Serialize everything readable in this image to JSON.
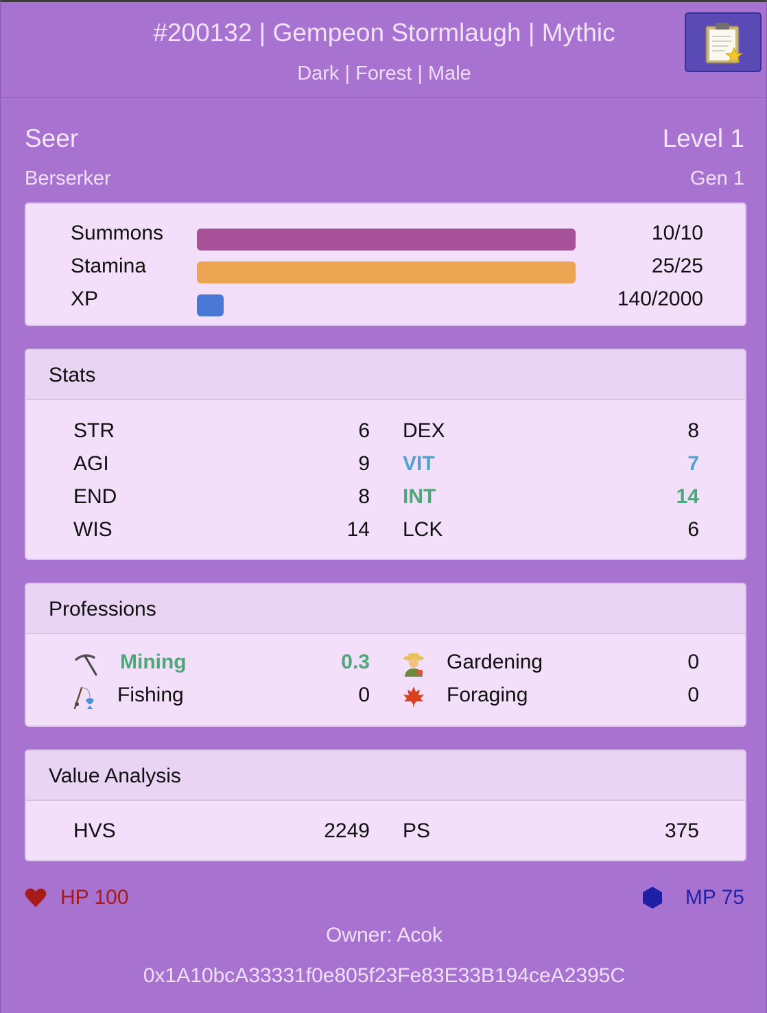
{
  "header": {
    "title": "#200132 | Gempeon Stormlaugh | Mythic",
    "subtitle": "Dark | Forest | Male",
    "clipboard_icon": "clipboard-star-icon"
  },
  "identity": {
    "main_class": "Seer",
    "level": "Level 1",
    "sub_class": "Berserker",
    "generation": "Gen 1"
  },
  "bars": [
    {
      "label": "Summons",
      "value": "10/10",
      "fraction": 1.0,
      "color": "#a65198"
    },
    {
      "label": "Stamina",
      "value": "25/25",
      "fraction": 1.0,
      "color": "#eca552"
    },
    {
      "label": "XP",
      "value": "140/2000",
      "fraction": 0.07,
      "color": "#4a78d6"
    }
  ],
  "stats": {
    "title": "Stats",
    "rows": [
      {
        "left_label": "STR",
        "left_value": "6",
        "right_label": "DEX",
        "right_value": "8"
      },
      {
        "left_label": "AGI",
        "left_value": "9",
        "right_label": "VIT",
        "right_value": "7"
      },
      {
        "left_label": "END",
        "left_value": "8",
        "right_label": "INT",
        "right_value": "14"
      },
      {
        "left_label": "WIS",
        "left_value": "14",
        "right_label": "LCK",
        "right_value": "6"
      }
    ],
    "highlight_colors": {
      "VIT": "#52a2cf",
      "INT": "#4ea779"
    }
  },
  "professions": {
    "title": "Professions",
    "rows": [
      {
        "left_icon": "pickaxe-icon",
        "left_label": "Mining",
        "left_value": "0.3",
        "right_icon": "farmer-icon",
        "right_label": "Gardening",
        "right_value": "0"
      },
      {
        "left_icon": "fishing-pole-icon",
        "left_label": "Fishing",
        "left_value": "0",
        "right_icon": "maple-leaf-icon",
        "right_label": "Foraging",
        "right_value": "0"
      }
    ],
    "highlight_color": "#4ea779"
  },
  "value_analysis": {
    "title": "Value Analysis",
    "hvs_label": "HVS",
    "hvs_value": "2249",
    "ps_label": "PS",
    "ps_value": "375"
  },
  "footer": {
    "hp": "HP 100",
    "hp_icon": "heart-icon",
    "hp_color": "#a51b17",
    "mp": "MP 75",
    "mp_icon": "hexagon-icon",
    "mp_color": "#2323a8",
    "owner": "Owner: Acok",
    "address": "0x1A10bcA33331f0e805f23Fe83E33B194ceA2395C"
  }
}
